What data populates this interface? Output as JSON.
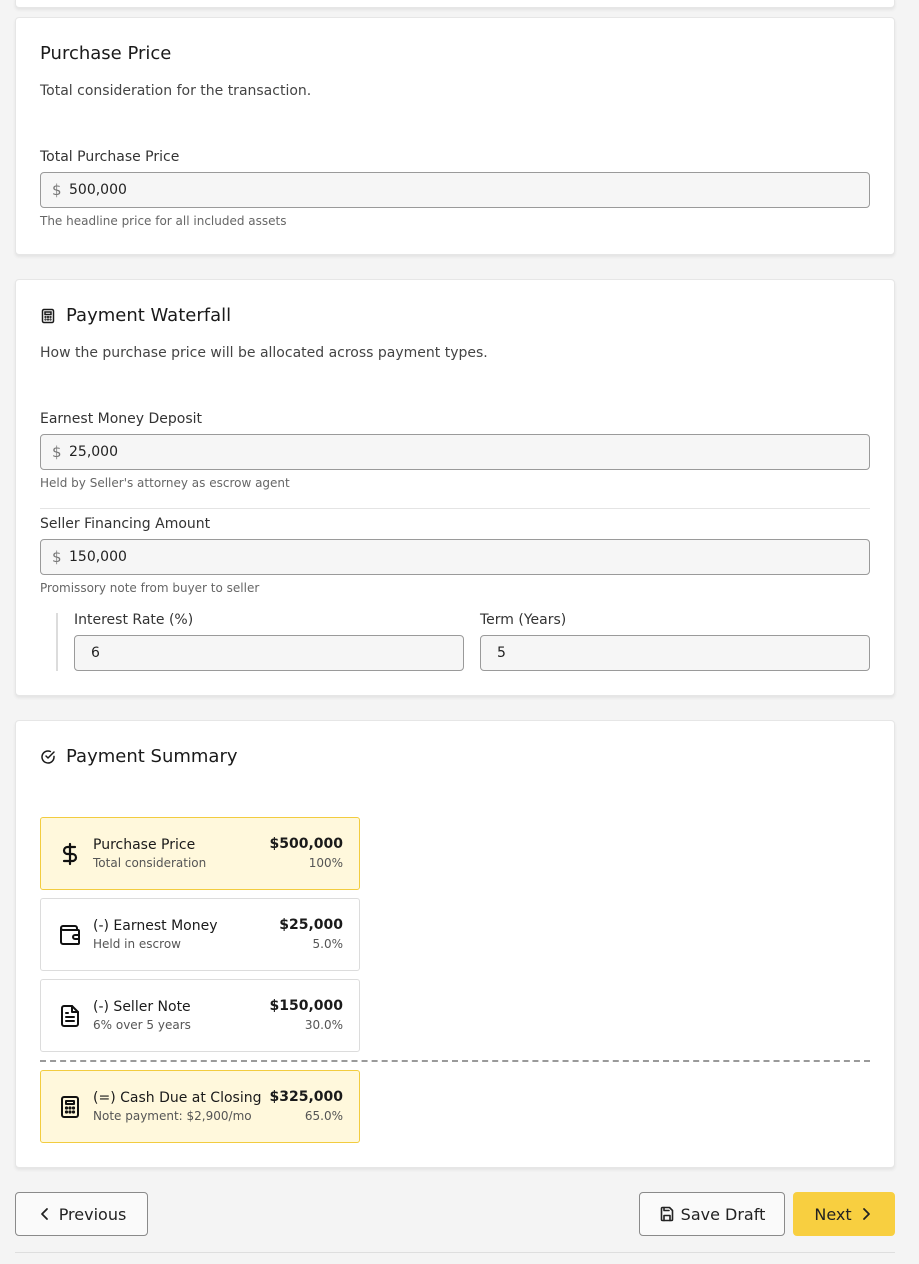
{
  "purchase_price": {
    "title": "Purchase Price",
    "subtitle": "Total consideration for the transaction.",
    "total_label": "Total Purchase Price",
    "currency_symbol": "$",
    "total_value": "500,000",
    "total_hint": "The headline price for all included assets"
  },
  "waterfall": {
    "title": "Payment Waterfall",
    "title_icon": "calculator-icon",
    "subtitle": "How the purchase price will be allocated across payment types.",
    "earnest_label": "Earnest Money Deposit",
    "earnest_value": "25,000",
    "earnest_hint": "Held by Seller's attorney as escrow agent",
    "financing_label": "Seller Financing Amount",
    "financing_value": "150,000",
    "financing_hint": "Promissory note from buyer to seller",
    "interest_label": "Interest Rate (%)",
    "interest_value": "6",
    "term_label": "Term (Years)",
    "term_value": "5"
  },
  "summary": {
    "title": "Payment Summary",
    "title_icon": "check-circle-icon",
    "items": [
      {
        "icon": "dollar-sign-icon",
        "name": "Purchase Price",
        "sub": "Total consideration",
        "amount": "$500,000",
        "percent": "100%",
        "highlight": true
      },
      {
        "icon": "wallet-icon",
        "name": "(-) Earnest Money",
        "sub": "Held in escrow",
        "amount": "$25,000",
        "percent": "5.0%",
        "highlight": false
      },
      {
        "icon": "document-icon",
        "name": "(-) Seller Note",
        "sub": "6% over 5 years",
        "amount": "$150,000",
        "percent": "30.0%",
        "highlight": false
      },
      {
        "icon": "calculator-icon",
        "name": "(=) Cash Due at Closing",
        "sub": "Note payment: $2,900/mo",
        "amount": "$325,000",
        "percent": "65.0%",
        "highlight": true
      }
    ]
  },
  "nav": {
    "previous": "Previous",
    "save_draft": "Save Draft",
    "next": "Next"
  },
  "colors": {
    "accent": "#f8cf40",
    "highlight_bg": "#fff8dc",
    "highlight_border": "#f2cc3f"
  }
}
